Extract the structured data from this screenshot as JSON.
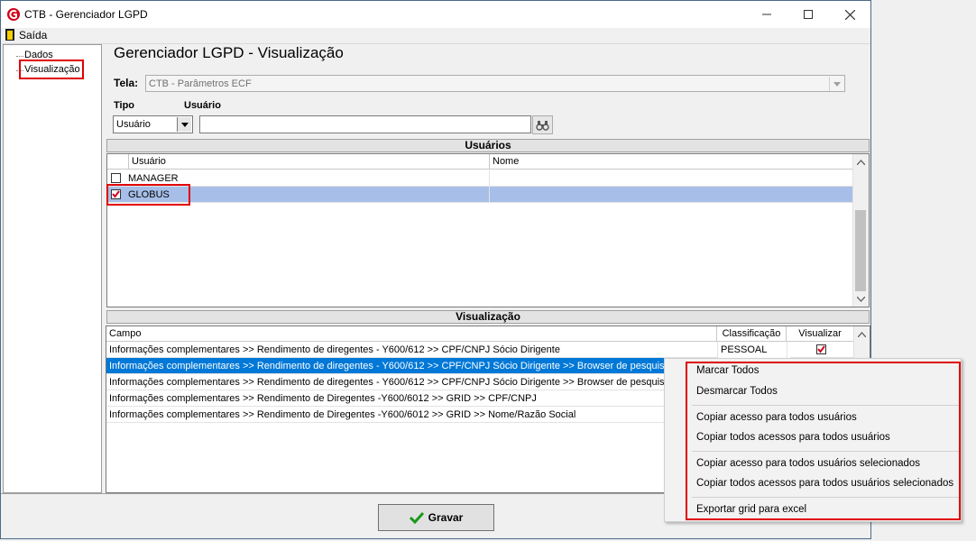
{
  "window": {
    "title": "CTB - Gerenciador LGPD"
  },
  "menu": {
    "exit_label": "Saída"
  },
  "tree": {
    "items": [
      {
        "label": "Dados"
      },
      {
        "label": "Visualização"
      }
    ]
  },
  "page": {
    "title": "Gerenciador LGPD - Visualização"
  },
  "form": {
    "tela_label": "Tela:",
    "tela_value": "CTB - Parâmetros ECF",
    "tipo_label": "Tipo",
    "tipo_value": "Usuário",
    "usuario_label": "Usuário",
    "usuario_value": ""
  },
  "users_panel": {
    "header": "Usuários",
    "columns": [
      "Usuário",
      "Nome"
    ],
    "rows": [
      {
        "user": "MANAGER",
        "name": "",
        "checked": false
      },
      {
        "user": "GLOBUS",
        "name": "",
        "checked": true
      }
    ]
  },
  "view_panel": {
    "header": "Visualização",
    "columns": [
      "Campo",
      "Classificação",
      "Visualizar"
    ],
    "rows": [
      {
        "campo": "Informações complementares >> Rendimento de diregentes - Y600/612 >> CPF/CNPJ Sócio Dirigente",
        "classificacao": "PESSOAL",
        "visualizar": true
      },
      {
        "campo": "Informações complementares >> Rendimento de diregentes - Y600/612 >> CPF/CNPJ Sócio Dirigente >> Browser de pesquisa >>",
        "classificacao": "",
        "visualizar": false
      },
      {
        "campo": "Informações complementares >> Rendimento de diregentes - Y600/612 >> CPF/CNPJ Sócio Dirigente >> Browser de pesquisa >>",
        "classificacao": "",
        "visualizar": false
      },
      {
        "campo": "Informações complementares >> Rendimento de Diregentes -Y600/6012 >> GRID >> CPF/CNPJ",
        "classificacao": "",
        "visualizar": false
      },
      {
        "campo": "Informações complementares >> Rendimento de Diregentes -Y600/6012 >> GRID >> Nome/Razão Social",
        "classificacao": "",
        "visualizar": false
      }
    ]
  },
  "buttons": {
    "save_label": "Gravar"
  },
  "context_menu": {
    "items": [
      "Marcar Todos",
      "Desmarcar Todos",
      "Copiar acesso para todos usuários",
      "Copiar todos acessos para todos usuários",
      "Copiar acesso para todos usuários selecionados",
      "Copiar todos acessos para todos usuários selecionados",
      "Exportar grid para excel"
    ]
  },
  "colors": {
    "highlight": "#e00000",
    "selection": "#0078d7",
    "selection_light": "#a7bfe8",
    "accent_red": "#d0021b"
  }
}
